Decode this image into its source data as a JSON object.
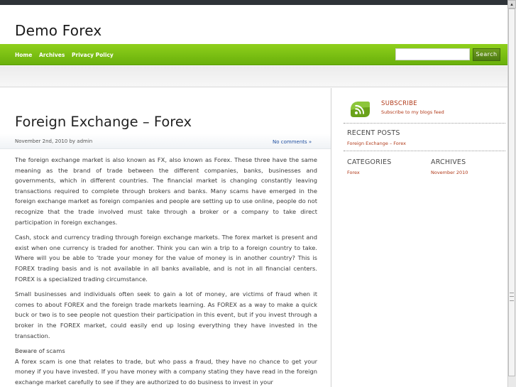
{
  "site": {
    "title": "Demo Forex"
  },
  "nav": {
    "items": [
      "Home",
      "Archives",
      "Privacy Policy"
    ],
    "search_placeholder": "",
    "search_label": "Search"
  },
  "post": {
    "title": "Foreign Exchange – Forex",
    "meta": "November 2nd, 2010 by admin",
    "comments": "No comments »",
    "paragraphs": [
      "The foreign exchange market is also known as FX, also known as Forex. These three have the same meaning as the brand of trade between the different companies, banks, businesses and governments, which in different countries. The financial market is changing constantly leaving transactions required to complete through brokers and banks. Many scams have emerged in the foreign exchange market as foreign companies and people are setting up to use online, people do not recognize that the trade involved must take through a broker or a company to take direct participation in foreign exchanges.",
      "Cash, stock and currency trading through foreign exchange markets. The forex market is present and exist when one currency is traded for another. Think you can win a trip to a foreign country to take. Where will you be able to ‘trade your money for the value of money is in another country? This is FOREX trading basis and is not available in all banks available, and is not in all financial centers. FOREX is a specialized trading circumstance.",
      "Small businesses and individuals often seek to gain a lot of money, are victims of fraud when it comes to about FOREX and the foreign trade markets learning. As FOREX as a way to make a quick buck or two is to see people not question their participation in this event, but if you invest through a broker in the FOREX market, could easily end up losing everything they have invested in the transaction.",
      "Beware of scams",
      "A forex scam is one that relates to trade, but who pass a fraud, they have no chance to get your money if you have invested. If you have money with a company stating they have read in the foreign exchange market carefully to see if they are authorized to do business to invest in your"
    ]
  },
  "sidebar": {
    "subscribe_title": "SUBSCRIBE",
    "subscribe_sub": "Subscribe to my blogs feed",
    "recent_heading": "RECENT POSTS",
    "recent_items": [
      "Foreign Exchange – Forex"
    ],
    "categories_heading": "CATEGORIES",
    "categories_items": [
      "Forex"
    ],
    "archives_heading": "ARCHIVES",
    "archives_items": [
      "November 2010"
    ]
  },
  "colors": {
    "nav_green": "#7dc014",
    "link_red": "#b13a1a",
    "comments_blue": "#1f4fa0",
    "topbar": "#2e3338"
  },
  "icons": {
    "rss": "rss-feed-icon",
    "scroll_up": "scroll-up-arrow-icon"
  }
}
